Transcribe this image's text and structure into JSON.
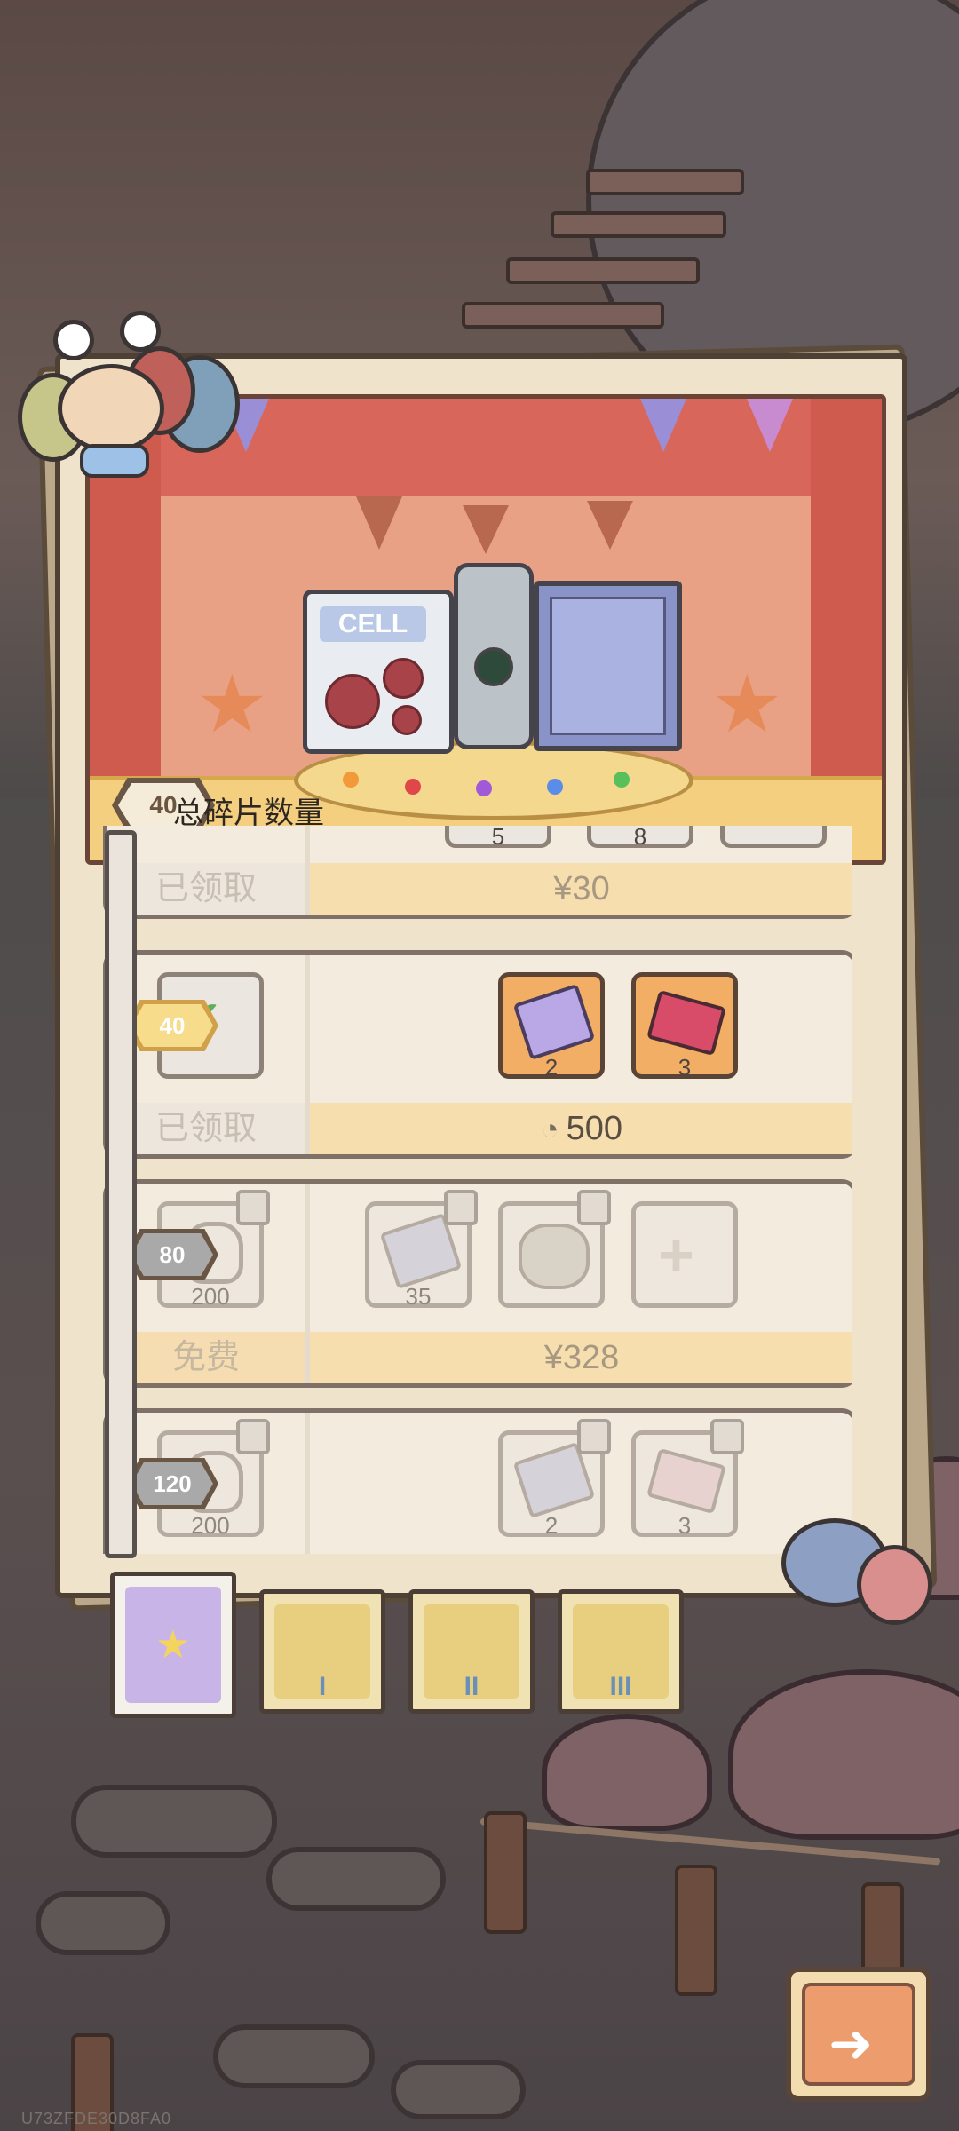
{
  "banner": {
    "book_label": "CELL",
    "total_count_value": "40",
    "total_count_label": "总碎片数量"
  },
  "rows": [
    {
      "milestone": "",
      "slots": [
        {
          "qty": "5",
          "state": "claimed"
        },
        {
          "qty": "8",
          "state": "claimed"
        },
        {
          "qty": "",
          "state": "claimed"
        }
      ],
      "left_label": "已领取",
      "price": "¥30"
    },
    {
      "milestone": "40",
      "slots": [
        {
          "qty": "2",
          "state": "unlocked",
          "icon": "ticket-card-icon"
        },
        {
          "qty": "3",
          "state": "unlocked",
          "icon": "red-ticket-icon"
        }
      ],
      "left_label": "已领取",
      "price": "500",
      "price_icon": "ghost-coin-icon"
    },
    {
      "milestone": "80",
      "left_slot_qty": "200",
      "slots": [
        {
          "qty": "35",
          "state": "locked",
          "icon": "ticket-card-icon"
        },
        {
          "qty": "",
          "state": "locked",
          "icon": "treasure-pile-icon"
        },
        {
          "qty": "",
          "state": "empty",
          "icon": "plus-icon"
        }
      ],
      "left_label": "免费",
      "price": "¥328"
    },
    {
      "milestone": "120",
      "left_slot_qty": "200",
      "slots": [
        {
          "qty": "2",
          "state": "locked",
          "icon": "ticket-card-icon"
        },
        {
          "qty": "3",
          "state": "locked",
          "icon": "red-ticket-icon"
        }
      ]
    }
  ],
  "tabs": [
    {
      "numeral": "",
      "selected": true
    },
    {
      "numeral": "I",
      "selected": false
    },
    {
      "numeral": "II",
      "selected": false
    },
    {
      "numeral": "III",
      "selected": false
    }
  ],
  "watermark": "U73ZFDE30D8FA0",
  "colors": {
    "accent_orange": "#f2ae64",
    "panel": "#efe3cb",
    "outline": "#4e4035"
  }
}
